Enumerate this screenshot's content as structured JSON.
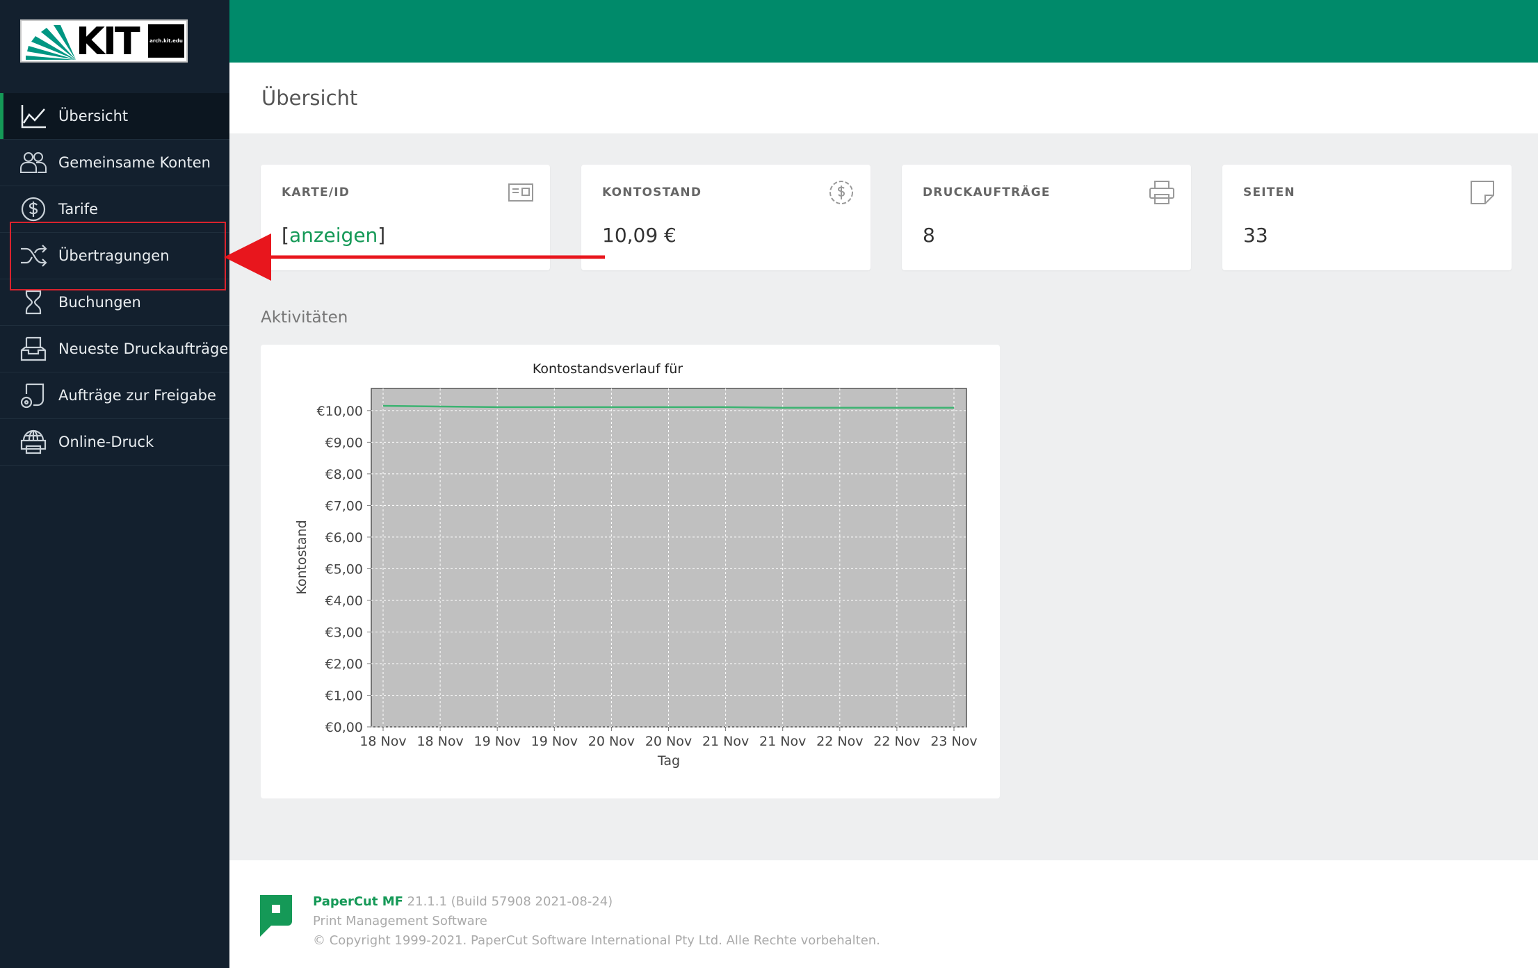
{
  "sidebar": {
    "logo": {
      "text": "KIT",
      "badge_text": "arch.kit.edu"
    },
    "items": [
      {
        "label": "Übersicht",
        "icon": "line-chart-icon",
        "active": true
      },
      {
        "label": "Gemeinsame Konten",
        "icon": "users-icon"
      },
      {
        "label": "Tarife",
        "icon": "dollar-circle-icon"
      },
      {
        "label": "Übertragungen",
        "icon": "shuffle-icon"
      },
      {
        "label": "Buchungen",
        "icon": "hourglass-icon"
      },
      {
        "label": "Neueste Druckaufträge",
        "icon": "inbox-icon"
      },
      {
        "label": "Aufträge zur Freigabe",
        "icon": "release-jobs-icon"
      },
      {
        "label": "Online-Druck",
        "icon": "web-print-icon"
      }
    ]
  },
  "header": {
    "title": "Übersicht"
  },
  "cards": [
    {
      "label": "KARTE/ID",
      "value_open": "[",
      "value_link": "anzeigen",
      "value_close": "]",
      "icon": "id-card-icon"
    },
    {
      "label": "KONTOSTAND",
      "value": "10,09 €",
      "icon": "dollar-circle-dashed-icon"
    },
    {
      "label": "DRUCKAUFTRÄGE",
      "value": "8",
      "icon": "printer-icon"
    },
    {
      "label": "SEITEN",
      "value": "33",
      "icon": "page-icon"
    }
  ],
  "activities": {
    "title": "Aktivitäten"
  },
  "chart_data": {
    "type": "line",
    "title": "Kontostandsverlauf für",
    "xlabel": "Tag",
    "ylabel": "Kontostand",
    "categories": [
      "18 Nov",
      "18 Nov",
      "19 Nov",
      "19 Nov",
      "20 Nov",
      "20 Nov",
      "21 Nov",
      "21 Nov",
      "22 Nov",
      "22 Nov",
      "23 Nov"
    ],
    "series": [
      {
        "values": [
          10.15,
          10.13,
          10.11,
          10.11,
          10.11,
          10.11,
          10.11,
          10.09,
          10.09,
          10.09,
          10.09
        ]
      }
    ],
    "ylim": [
      0,
      10.7
    ],
    "yticks": [
      "€0,00",
      "€1,00",
      "€2,00",
      "€3,00",
      "€4,00",
      "€5,00",
      "€6,00",
      "€7,00",
      "€8,00",
      "€9,00",
      "€10,00"
    ],
    "ytick_values": [
      0,
      1,
      2,
      3,
      4,
      5,
      6,
      7,
      8,
      9,
      10
    ],
    "grid": true,
    "colors": {
      "line": "#3cb371",
      "plot_bg": "#c0c0c0"
    }
  },
  "footer": {
    "brand": "PaperCut MF",
    "version": "21.1.1 (Build 57908 2021-08-24)",
    "subtitle": "Print Management Software",
    "copyright": "© Copyright 1999-2021. PaperCut Software International Pty Ltd. Alle Rechte vorbehalten."
  },
  "colors": {
    "accent": "#159957",
    "topbar": "#008a6a",
    "sidebar": "#13202e",
    "annotation": "#e8161d"
  }
}
